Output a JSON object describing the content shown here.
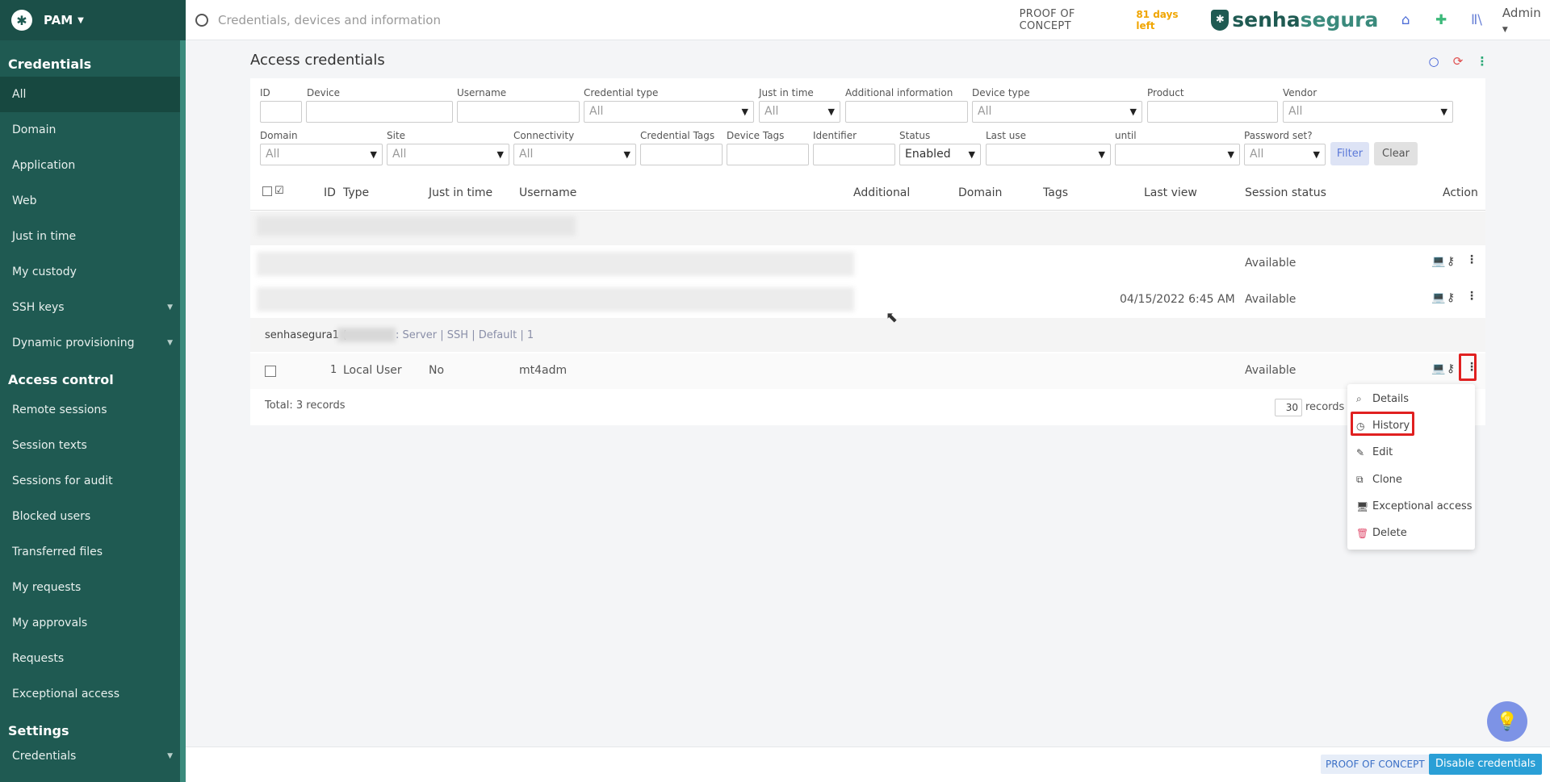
{
  "brand": {
    "app": "PAM"
  },
  "sidebar": {
    "section_credentials": "Credentials",
    "items_credentials": [
      {
        "label": "All"
      },
      {
        "label": "Domain"
      },
      {
        "label": "Application"
      },
      {
        "label": "Web"
      },
      {
        "label": "Just in time"
      },
      {
        "label": "My custody"
      },
      {
        "label": "SSH keys"
      },
      {
        "label": "Dynamic provisioning"
      }
    ],
    "section_access": "Access control",
    "items_access": [
      {
        "label": "Remote sessions"
      },
      {
        "label": "Session texts"
      },
      {
        "label": "Sessions for audit"
      },
      {
        "label": "Blocked users"
      },
      {
        "label": "Transferred files"
      },
      {
        "label": "My requests"
      },
      {
        "label": "My approvals"
      },
      {
        "label": "Requests"
      },
      {
        "label": "Exceptional access"
      }
    ],
    "section_settings": "Settings",
    "items_settings": [
      {
        "label": "Credentials"
      }
    ]
  },
  "topbar": {
    "search_placeholder": "Credentials, devices and information",
    "poc": "PROOF OF CONCEPT",
    "days_left": "81 days left",
    "logo_a": "senha",
    "logo_b": "segura",
    "user": "Admin"
  },
  "page": {
    "title": "Access credentials"
  },
  "filters": {
    "id": "ID",
    "device": "Device",
    "username": "Username",
    "credential_type": "Credential type",
    "just_in_time": "Just in time",
    "additional_info": "Additional information",
    "device_type": "Device type",
    "product": "Product",
    "vendor": "Vendor",
    "domain": "Domain",
    "site": "Site",
    "connectivity": "Connectivity",
    "credential_tags": "Credential Tags",
    "device_tags": "Device Tags",
    "identifier": "Identifier",
    "status": "Status",
    "last_use": "Last use",
    "until": "until",
    "password_set": "Password set?",
    "all": "All",
    "status_value": "Enabled",
    "filter_btn": "Filter",
    "clear_btn": "Clear"
  },
  "table": {
    "headers": {
      "id": "ID",
      "type": "Type",
      "jit": "Just in time",
      "username": "Username",
      "additional": "Additional",
      "domain": "Domain",
      "tags": "Tags",
      "last_view": "Last view",
      "session_status": "Session status",
      "action": "Action"
    },
    "row1": {
      "status": "Available"
    },
    "row2": {
      "last_view": "04/15/2022 6:45 AM",
      "status": "Available"
    },
    "group_label": "senhasegura1 (",
    "group_suffix": ": Server | SSH | Default | 1",
    "row3": {
      "id": "1",
      "type": "Local User",
      "jit": "No",
      "username": "mt4adm",
      "status": "Available"
    },
    "total": "Total: 3 records",
    "per_page": "30",
    "records": "records"
  },
  "menu": {
    "details": "Details",
    "history": "History",
    "edit": "Edit",
    "clone": "Clone",
    "exceptional": "Exceptional access",
    "delete": "Delete"
  },
  "footer": {
    "poc": "PROOF OF CONCEPT",
    "disable": "Disable credentials"
  }
}
